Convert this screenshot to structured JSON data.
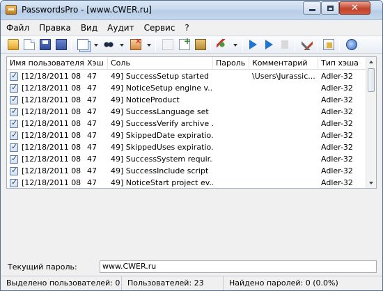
{
  "window": {
    "title": "PasswordsPro - [www.CWER.ru]"
  },
  "menu": [
    "Файл",
    "Правка",
    "Вид",
    "Аудит",
    "Сервис",
    "?"
  ],
  "columns": [
    "Имя пользователя",
    "Хэш",
    "Соль",
    "Пароль",
    "Комментарий",
    "Тип хэша"
  ],
  "rows": [
    {
      "user": "[12/18/2011 08",
      "hash": "47",
      "salt": "49] SuccessSetup started",
      "password": "",
      "comment": "\\Users\\Jurassic...",
      "type": "Adler-32"
    },
    {
      "user": "[12/18/2011 08",
      "hash": "47",
      "salt": "49] NoticeSetup engine v...",
      "password": "",
      "comment": "",
      "type": "Adler-32"
    },
    {
      "user": "[12/18/2011 08",
      "hash": "47",
      "salt": "49] NoticeProduct",
      "password": "",
      "comment": "",
      "type": "Adler-32"
    },
    {
      "user": "[12/18/2011 08",
      "hash": "47",
      "salt": "49] SuccessLanguage set",
      "password": "",
      "comment": "",
      "type": "Adler-32"
    },
    {
      "user": "[12/18/2011 08",
      "hash": "47",
      "salt": "49] SuccessVerify archive ...",
      "password": "",
      "comment": "",
      "type": "Adler-32"
    },
    {
      "user": "[12/18/2011 08",
      "hash": "47",
      "salt": "49] SkippedDate expiratio...",
      "password": "",
      "comment": "",
      "type": "Adler-32"
    },
    {
      "user": "[12/18/2011 08",
      "hash": "47",
      "salt": "49] SkippedUses expiratio...",
      "password": "",
      "comment": "",
      "type": "Adler-32"
    },
    {
      "user": "[12/18/2011 08",
      "hash": "47",
      "salt": "49] SuccessSystem requir...",
      "password": "",
      "comment": "",
      "type": "Adler-32"
    },
    {
      "user": "[12/18/2011 08",
      "hash": "47",
      "salt": "49] SuccessInclude script",
      "password": "",
      "comment": "",
      "type": "Adler-32"
    },
    {
      "user": "[12/18/2011 08",
      "hash": "47",
      "salt": "49] NoticeStart project ev...",
      "password": "",
      "comment": "",
      "type": "Adler-32"
    }
  ],
  "current_password": {
    "label": "Текущий пароль:",
    "value": "www.CWER.ru"
  },
  "status": {
    "selected": "Выделено пользователей: 0",
    "users": "Пользователей: 23",
    "found": "Найдено паролей: 0 (0.0%)"
  },
  "toolbar_icons": [
    "open-icon",
    "new-icon",
    "save-icon",
    "save-all-icon",
    "copy-icon",
    "find-icon",
    "delete-icon",
    "edit-icon",
    "add-row-icon",
    "paste-icon",
    "tools-icon",
    "play-icon",
    "play-step-icon",
    "stop-icon",
    "settings-icon",
    "export-icon",
    "globe-icon"
  ]
}
